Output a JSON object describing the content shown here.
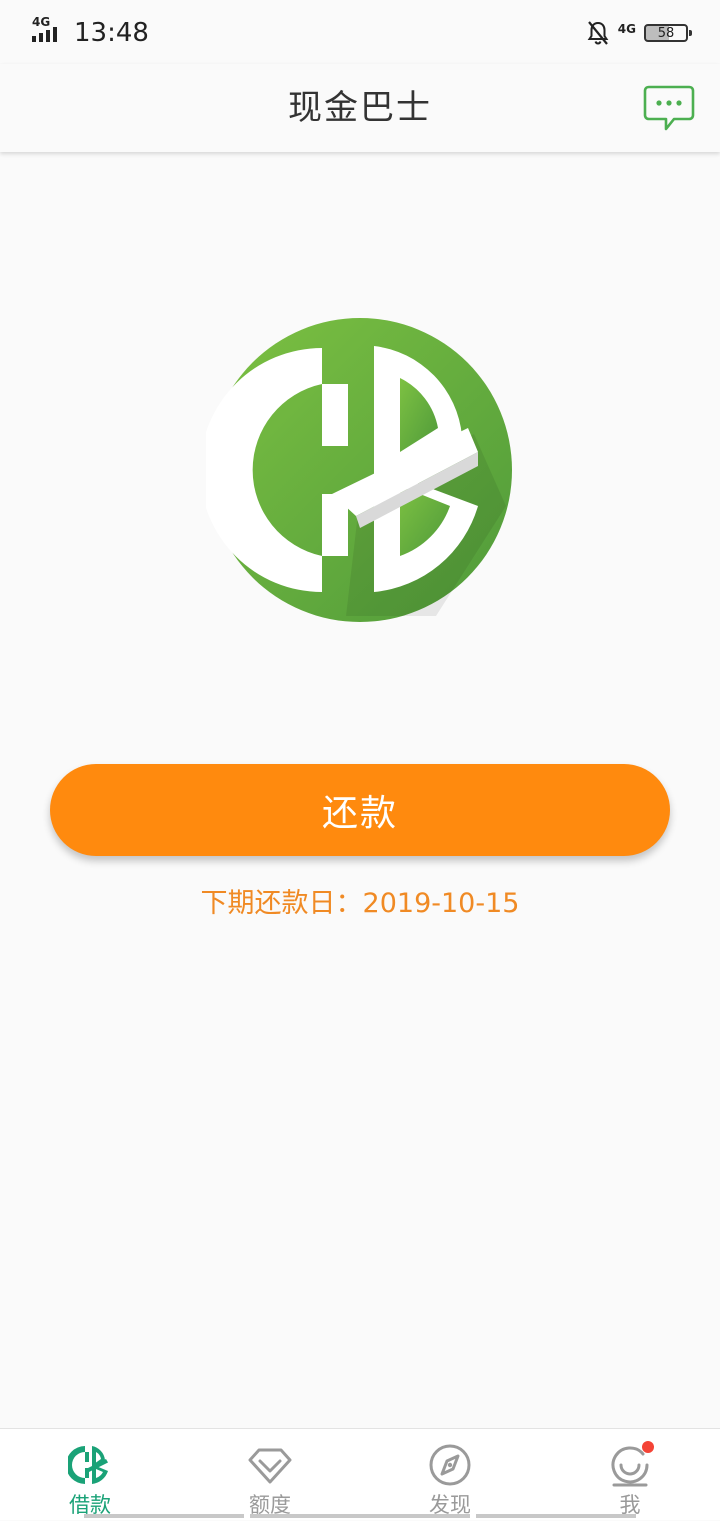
{
  "status_bar": {
    "network_left": "4G",
    "time": "13:48",
    "network_right": "4G",
    "battery": "58",
    "icons": [
      "signal-icon",
      "bell-muted-icon",
      "battery-icon"
    ]
  },
  "header": {
    "title": "现金巴士",
    "message_icon": "chat-bubble-icon"
  },
  "main": {
    "logo_icon": "cashbus-logo",
    "repay_label": "还款",
    "due_date_text": "下期还款日：2019-10-15"
  },
  "bottom_nav": {
    "items": [
      {
        "label": "借款",
        "icon": "cashbus-logo-icon",
        "active": true
      },
      {
        "label": "额度",
        "icon": "diamond-icon",
        "active": false
      },
      {
        "label": "发现",
        "icon": "compass-icon",
        "active": false
      },
      {
        "label": "我",
        "icon": "smile-icon",
        "active": false
      }
    ]
  },
  "colors": {
    "brand_green": "#5fa63a",
    "accent_orange": "#ff8a0e",
    "active_tab": "#1aa277",
    "inactive_tab": "#9a9a9a"
  }
}
